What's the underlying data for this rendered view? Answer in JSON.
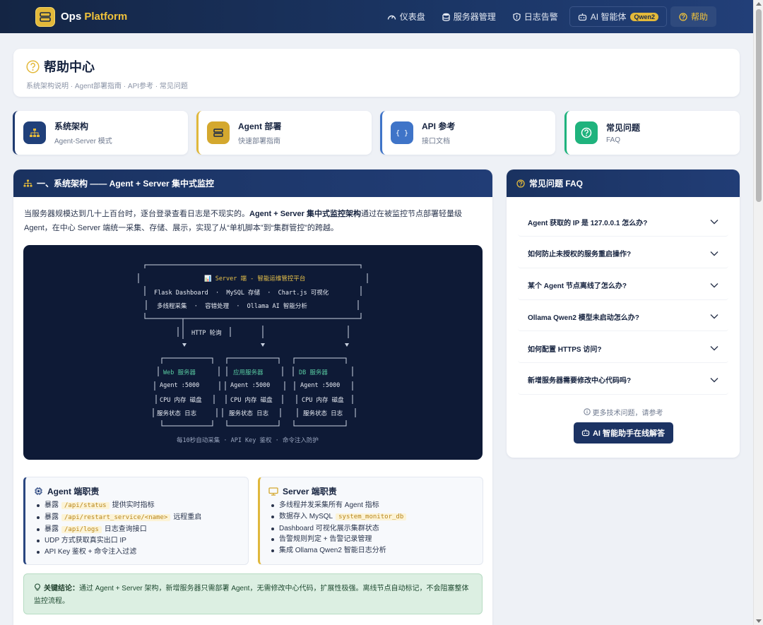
{
  "brand": {
    "name": "Ops",
    "accent": "Platform"
  },
  "nav": {
    "dashboard": "仪表盘",
    "servers": "服务器管理",
    "logs": "日志告警",
    "ai": "AI 智能体",
    "ai_badge": "Qwen2",
    "help": "帮助"
  },
  "header": {
    "title": "帮助中心",
    "subtitle": "系统架构说明 · Agent部署指南 · API参考 · 常见问题"
  },
  "quick": [
    {
      "title": "系统架构",
      "sub": "Agent-Server 模式"
    },
    {
      "title": "Agent 部署",
      "sub": "快速部署指南"
    },
    {
      "title": "API 参考",
      "sub": "接口文档"
    },
    {
      "title": "常见问题",
      "sub": "FAQ"
    }
  ],
  "arch": {
    "header": "一、系统架构 —— Agent + Server 集中式监控",
    "intro_1": "当服务器规模达到几十上百台时，逐台登录查看日志是不现实的。",
    "intro_bold": "Agent + Server 集中式监控架构",
    "intro_2": "通过在被监控节点部署轻量级 Agent，在中心 Server 端统一采集、存储、展示，实现了从“单机脚本”到“集群管控”的跨越。",
    "diagram": {
      "server_title": "📊 Server 端 - 智能运维管控平台",
      "server_line1": "Flask Dashboard  ·  MySQL 存储  ·  Chart.js 可视化",
      "server_line2": "多线程采集  ·  容错处理  ·  Ollama AI 智能分析",
      "http": "HTTP 轮询",
      "node1_title": "Web 服务器",
      "node2_title": "应用服务器",
      "node3_title": "DB 服务器",
      "node_agent": "Agent :5000",
      "node_metrics": "CPU 内存 磁盘",
      "node_status": "服务状态 日志",
      "footer": "每10秒自动采集 · API Key 鉴权 · 命令注入防护"
    },
    "agent_duty": {
      "title": "Agent 端职责",
      "items": [
        {
          "pre": "暴露",
          "code": "/api/status",
          "post": "提供实时指标"
        },
        {
          "pre": "暴露",
          "code": "/api/restart_service/<name>",
          "post": "远程重启"
        },
        {
          "pre": "暴露",
          "code": "/api/logs",
          "post": "日志查询接口"
        },
        {
          "pre": "UDP 方式获取真实出口 IP",
          "code": "",
          "post": ""
        },
        {
          "pre": "API Key 鉴权 + 命令注入过滤",
          "code": "",
          "post": ""
        }
      ]
    },
    "server_duty": {
      "title": "Server 端职责",
      "items": [
        {
          "pre": "多线程并发采集所有 Agent 指标",
          "code": "",
          "post": ""
        },
        {
          "pre": "数据存入 MySQL",
          "code": "system_monitor_db",
          "post": ""
        },
        {
          "pre": "Dashboard 可视化展示集群状态",
          "code": "",
          "post": ""
        },
        {
          "pre": "告警规则判定 + 告警记录管理",
          "code": "",
          "post": ""
        },
        {
          "pre": "集成 Ollama Qwen2 智能日志分析",
          "code": "",
          "post": ""
        }
      ]
    },
    "conclusion_label": "关键结论：",
    "conclusion_text": "通过 Agent + Server 架构，新增服务器只需部署 Agent，无需修改中心代码，扩展性极强。离线节点自动标记，不会阻塞整体监控流程。"
  },
  "faq": {
    "header": "常见问题 FAQ",
    "items": [
      "Agent 获取的 IP 是 127.0.0.1 怎么办?",
      "如何防止未授权的服务重启操作?",
      "某个 Agent 节点离线了怎么办?",
      "Ollama Qwen2 模型未启动怎么办?",
      "如何配置 HTTPS 访问?",
      "新增服务器需要修改中心代码吗?"
    ],
    "more": "更多技术问题，请参考",
    "button": "AI 智能助手在线解答"
  },
  "colors": {
    "navy": "#1a3260",
    "gold": "#e3b93a",
    "green": "#1fb37d",
    "blue": "#3f74c8"
  }
}
